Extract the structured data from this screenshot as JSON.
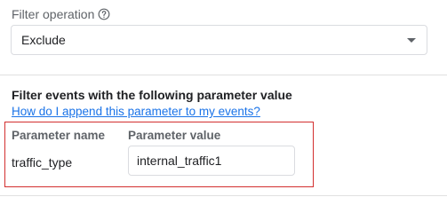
{
  "filter_operation": {
    "label": "Filter operation",
    "help_icon": "help-circle-icon",
    "selected": "Exclude"
  },
  "parameter_section": {
    "title": "Filter events with the following parameter value",
    "help_link": "How do I append this parameter to my events?",
    "headers": {
      "name": "Parameter name",
      "value": "Parameter value"
    },
    "row": {
      "name": "traffic_type",
      "value": "internal_traffic1"
    },
    "highlight_color": "#d32f2f"
  },
  "colors": {
    "link": "#1a73e8",
    "label": "#5f6368",
    "border": "#dadce0"
  }
}
